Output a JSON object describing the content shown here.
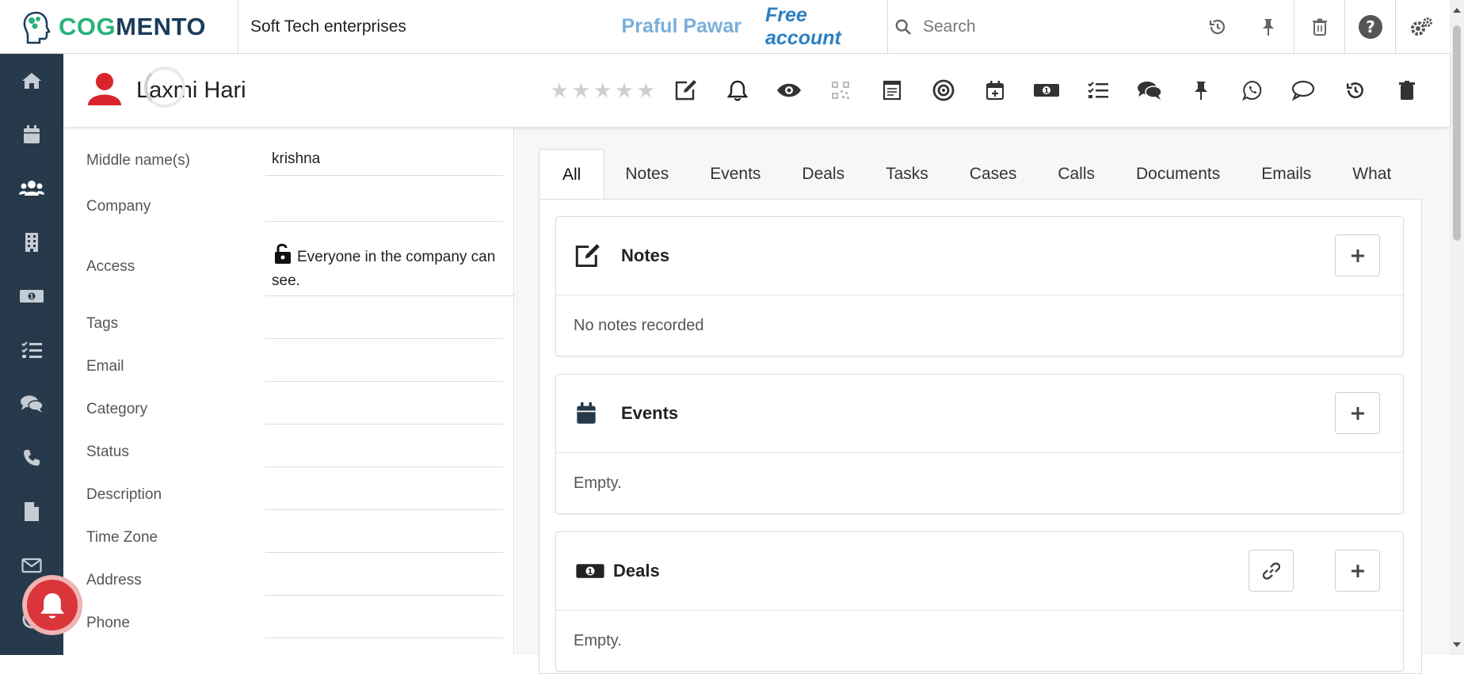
{
  "topbar": {
    "logo_cog": "COG",
    "logo_mento": "MENTO",
    "company": "Soft Tech enterprises",
    "user_name": "Praful Pawar",
    "account_type": "Free account",
    "search_placeholder": "Search"
  },
  "sidebar": {
    "items": [
      "home-icon",
      "calendar-icon",
      "contacts-icon",
      "companies-icon",
      "deals-icon",
      "tasks-icon",
      "cases-icon",
      "calls-icon",
      "documents-icon",
      "email-icon",
      "campaigns-icon"
    ],
    "active": "contacts-icon"
  },
  "contact": {
    "name": "Laxmi Hari",
    "rating": 0,
    "max_rating": 5,
    "fields": [
      {
        "label": "Middle name(s)",
        "value": "krishna"
      },
      {
        "label": "Company",
        "value": ""
      },
      {
        "label": "Access",
        "value": "Everyone in the company can see."
      },
      {
        "label": "Tags",
        "value": ""
      },
      {
        "label": "Email",
        "value": ""
      },
      {
        "label": "Category",
        "value": ""
      },
      {
        "label": "Status",
        "value": ""
      },
      {
        "label": "Description",
        "value": ""
      },
      {
        "label": "Time Zone",
        "value": ""
      },
      {
        "label": "Address",
        "value": ""
      },
      {
        "label": "Phone",
        "value": ""
      }
    ]
  },
  "tabs": [
    "All",
    "Notes",
    "Events",
    "Deals",
    "Tasks",
    "Cases",
    "Calls",
    "Documents",
    "Emails",
    "What"
  ],
  "active_tab": "All",
  "cards": [
    {
      "title": "Notes",
      "body": "No notes recorded"
    },
    {
      "title": "Events",
      "body": "Empty."
    },
    {
      "title": "Deals",
      "body": "Empty."
    }
  ],
  "colors": {
    "sidebar": "#263a4b",
    "brand_green": "#2ab27b",
    "brand_navy": "#1b3c5a",
    "user_name": "#7aaedc",
    "account": "#2d80c2",
    "avatar": "#d8252b",
    "notification": "#d9353a"
  }
}
